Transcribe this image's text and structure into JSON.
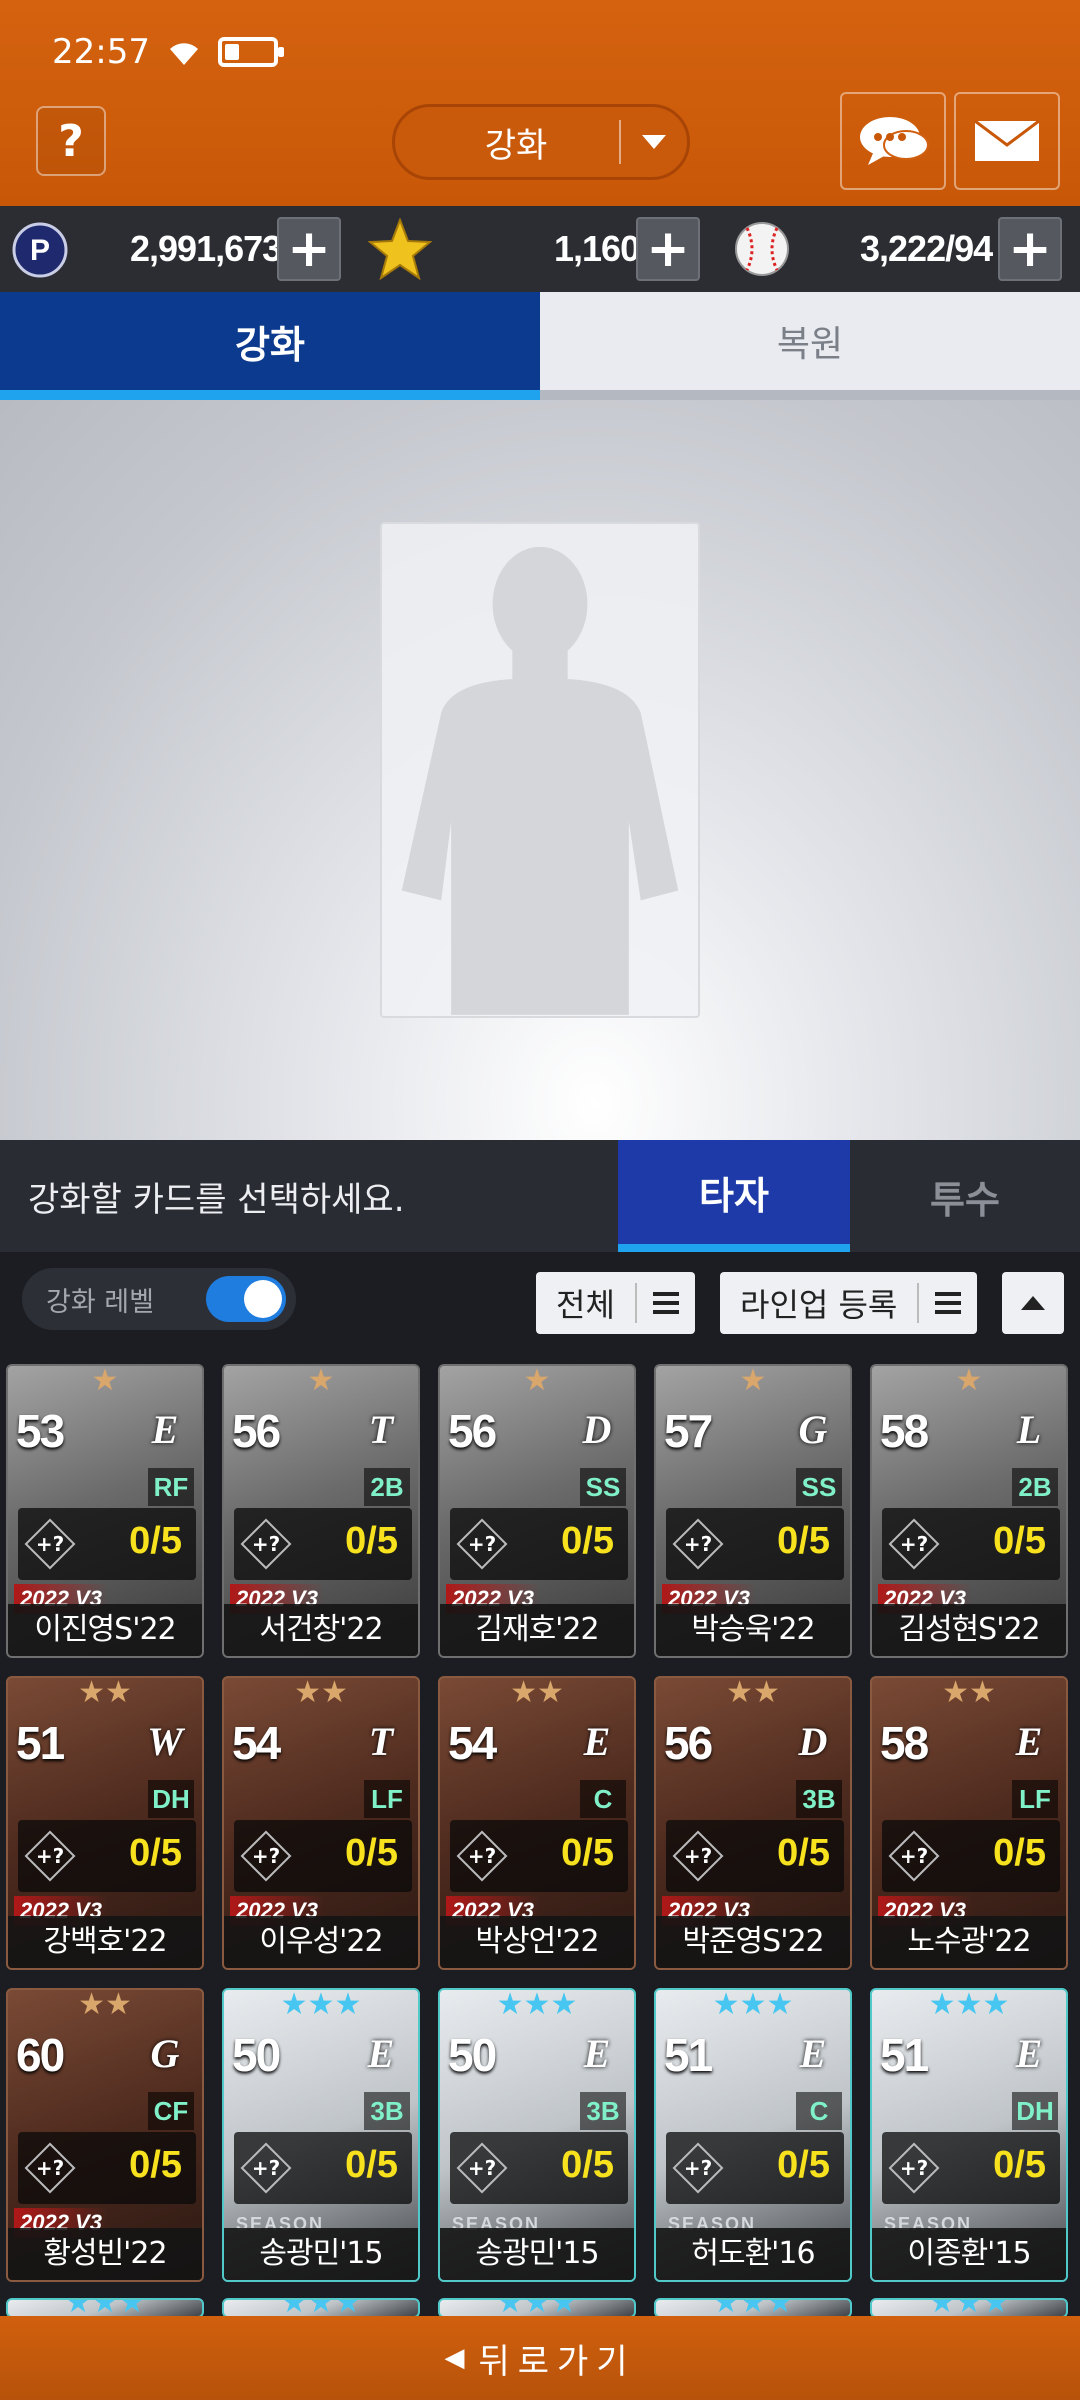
{
  "status_bar": {
    "time": "22:57",
    "battery_level": 0.3
  },
  "header": {
    "help_label": "?",
    "title": "강화"
  },
  "currencies": [
    {
      "icon": "p-coin-icon",
      "value": "2,991,673"
    },
    {
      "icon": "gold-star-icon",
      "value": "1,160"
    },
    {
      "icon": "baseball-icon",
      "value": "3,222/94"
    }
  ],
  "main_tabs": {
    "upgrade": "강화",
    "restore": "복원"
  },
  "select_bar": {
    "message": "강화할 카드를 선택하세요.",
    "batter_tab": "타자",
    "pitcher_tab": "투수"
  },
  "filters": {
    "toggle_label": "강화 레벨",
    "toggle_on": true,
    "all_label": "전체",
    "lineup_label": "라인업 등록"
  },
  "cards": [
    {
      "stars": "★",
      "star_color": "bronze",
      "ovr": "53",
      "team": "E",
      "position": "RF",
      "upgrade": "+?",
      "progress": "0/5",
      "edition": "2022 V3",
      "name": "이진영S'22"
    },
    {
      "stars": "★",
      "star_color": "bronze",
      "ovr": "56",
      "team": "T",
      "position": "2B",
      "upgrade": "+?",
      "progress": "0/5",
      "edition": "2022 V3",
      "name": "서건창'22"
    },
    {
      "stars": "★",
      "star_color": "bronze",
      "ovr": "56",
      "team": "D",
      "position": "SS",
      "upgrade": "+?",
      "progress": "0/5",
      "edition": "2022 V3",
      "name": "김재호'22"
    },
    {
      "stars": "★",
      "star_color": "bronze",
      "ovr": "57",
      "team": "G",
      "position": "SS",
      "upgrade": "+?",
      "progress": "0/5",
      "edition": "2022 V3",
      "name": "박승욱'22"
    },
    {
      "stars": "★",
      "star_color": "bronze",
      "ovr": "58",
      "team": "L",
      "position": "2B",
      "upgrade": "+?",
      "progress": "0/5",
      "edition": "2022 V3",
      "name": "김성현S'22"
    },
    {
      "stars": "★★",
      "star_color": "bronze",
      "ovr": "51",
      "team": "W",
      "position": "DH",
      "upgrade": "+?",
      "progress": "0/5",
      "edition": "2022 V3",
      "name": "강백호'22"
    },
    {
      "stars": "★★",
      "star_color": "bronze",
      "ovr": "54",
      "team": "T",
      "position": "LF",
      "upgrade": "+?",
      "progress": "0/5",
      "edition": "2022 V3",
      "name": "이우성'22"
    },
    {
      "stars": "★★",
      "star_color": "bronze",
      "ovr": "54",
      "team": "E",
      "position": "C",
      "upgrade": "+?",
      "progress": "0/5",
      "edition": "2022 V3",
      "name": "박상언'22"
    },
    {
      "stars": "★★",
      "star_color": "bronze",
      "ovr": "56",
      "team": "D",
      "position": "3B",
      "upgrade": "+?",
      "progress": "0/5",
      "edition": "2022 V3",
      "name": "박준영S'22"
    },
    {
      "stars": "★★",
      "star_color": "bronze",
      "ovr": "58",
      "team": "E",
      "position": "LF",
      "upgrade": "+?",
      "progress": "0/5",
      "edition": "2022 V3",
      "name": "노수광'22"
    },
    {
      "stars": "★★",
      "star_color": "bronze",
      "ovr": "60",
      "team": "G",
      "position": "CF",
      "upgrade": "+?",
      "progress": "0/5",
      "edition": "2022 V3",
      "name": "황성빈'22"
    },
    {
      "stars": "★★★",
      "star_color": "teal",
      "ovr": "50",
      "team": "E",
      "position": "3B",
      "upgrade": "+?",
      "progress": "0/5",
      "edition": "SEASON",
      "name": "송광민'15"
    },
    {
      "stars": "★★★",
      "star_color": "teal",
      "ovr": "50",
      "team": "E",
      "position": "3B",
      "upgrade": "+?",
      "progress": "0/5",
      "edition": "SEASON",
      "name": "송광민'15"
    },
    {
      "stars": "★★★",
      "star_color": "teal",
      "ovr": "51",
      "team": "E",
      "position": "C",
      "upgrade": "+?",
      "progress": "0/5",
      "edition": "SEASON",
      "name": "허도환'16"
    },
    {
      "stars": "★★★",
      "star_color": "teal",
      "ovr": "51",
      "team": "E",
      "position": "DH",
      "upgrade": "+?",
      "progress": "0/5",
      "edition": "SEASON",
      "name": "이종환'15"
    }
  ],
  "partial_row_stars": [
    "★★★",
    "★★★",
    "★★★",
    "★★★",
    "★★★"
  ],
  "back_button": {
    "label": "뒤로가기"
  },
  "colors": {
    "header_orange": "#c85808",
    "active_tab_blue": "#0c3a8e",
    "accent_cyan": "#1fa3ee",
    "progress_yellow": "#f7e21d"
  }
}
